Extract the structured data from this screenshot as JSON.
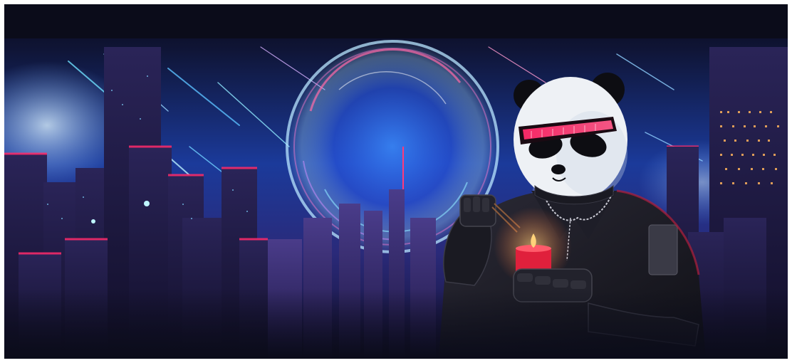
{
  "scene": {
    "subject": "panda-character",
    "setting": "neon-city-skyline",
    "colors": {
      "background": "#0b0c1a",
      "sky_top": "#101536",
      "sky_glow": "#1f5ff0",
      "portal": "#8fd0ff",
      "neon_pink": "#ff2a6a",
      "neon_magenta": "#d23cff",
      "building_dark": "#141330",
      "building_mid": "#2a2458",
      "window_lights": "#ffb35c",
      "jacket": "#1a1a22",
      "fur_white": "#eef1f5",
      "fur_black": "#0d0d12",
      "candle": "#e0203c",
      "flame": "#ffd27a"
    }
  }
}
